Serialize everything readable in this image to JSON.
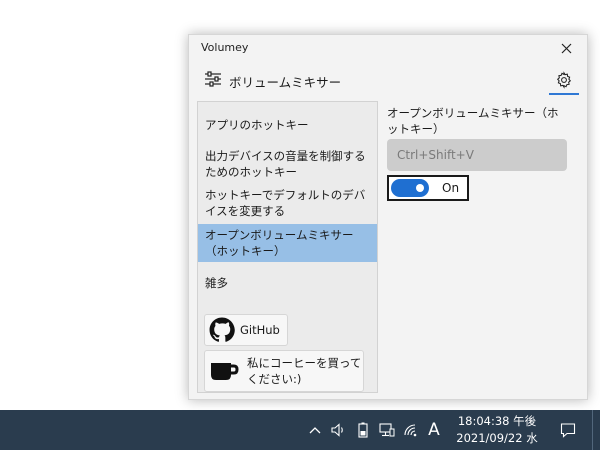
{
  "window": {
    "title": "Volumey",
    "header_title": "ボリュームミキサー"
  },
  "sidebar": {
    "items": [
      {
        "label": "アプリのホットキー"
      },
      {
        "label": "出力デバイスの音量を制御するためのホットキー"
      },
      {
        "label": "ホットキーでデフォルトのデバイスを変更する"
      },
      {
        "label": "オープンボリュームミキサー（ホットキー）"
      },
      {
        "label": "雑多"
      }
    ],
    "selected_index": 3,
    "github_label": "GitHub",
    "coffee_label": "私にコーヒーを買ってください:)"
  },
  "content": {
    "section_label": "オープンボリュームミキサー（ホットキー）",
    "hotkey_placeholder": "Ctrl+Shift+V",
    "toggle_label": "On",
    "toggle_on": true
  },
  "taskbar": {
    "ime_label": "A",
    "time": "18:04:38 午後",
    "date": "2021/09/22 水"
  },
  "colors": {
    "accent": "#1f6fd1",
    "selected_item": "#97bfe6",
    "taskbar": "#2a3c4e"
  }
}
